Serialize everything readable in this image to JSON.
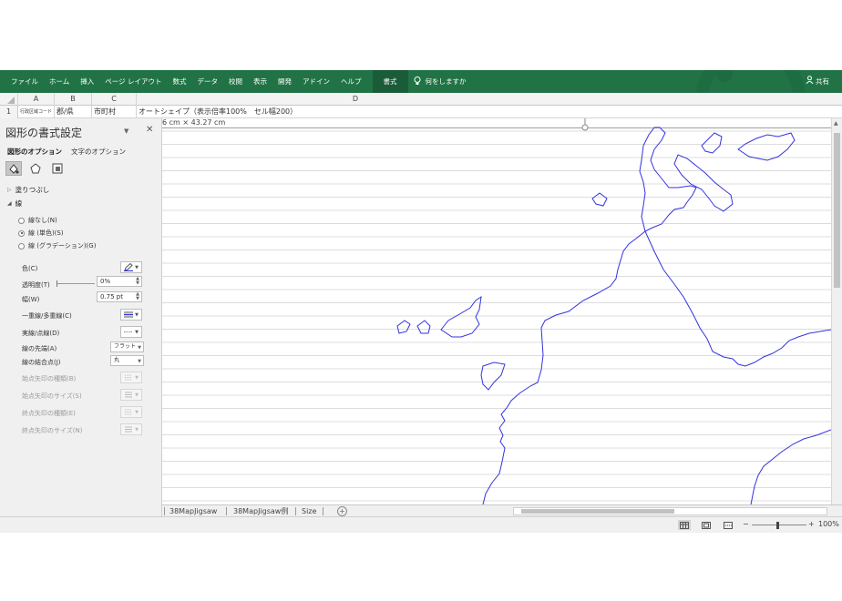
{
  "ribbon": {
    "tabs": [
      "ファイル",
      "ホーム",
      "挿入",
      "ページ レイアウト",
      "数式",
      "データ",
      "校閲",
      "表示",
      "開発",
      "アドイン",
      "ヘルプ",
      "書式"
    ],
    "active_tab": "書式",
    "tell_me": "何をしますか",
    "share": "共有",
    "accent_color": "#217346"
  },
  "columns": [
    "A",
    "B",
    "C",
    "D"
  ],
  "row1": {
    "num": "1",
    "a": "行政区域コード",
    "b": "郡/県",
    "c": "市町村",
    "d": "オートシェイプ（表示倍率100%　セル幅200）"
  },
  "shape_size_label": "6 cm × 43.27 cm",
  "pane": {
    "title": "図形の書式設定",
    "tab_shape": "図形のオプション",
    "tab_text": "文字のオプション",
    "fill_section": "塗りつぶし",
    "line_section": "線",
    "radio_none": "線なし(N)",
    "radio_solid": "線 (単色)(S)",
    "radio_gradient": "線 (グラデーション)(G)",
    "color_label": "色(C)",
    "transparency_label": "透明度(T)",
    "transparency_value": "0%",
    "width_label": "幅(W)",
    "width_value": "0.75 pt",
    "compound_label": "一重線/多重線(C)",
    "dash_label": "実線/点線(D)",
    "cap_label": "線の先端(A)",
    "cap_value": "フラット",
    "join_label": "線の結合点(J)",
    "join_value": "丸",
    "begin_arrow_type": "始点矢印の種類(B)",
    "begin_arrow_size": "始点矢印のサイズ(S)",
    "end_arrow_type": "終点矢印の種類(E)",
    "end_arrow_size": "終点矢印のサイズ(N)"
  },
  "sheets": [
    "38MapJigsaw",
    "38MapJigsaw例",
    "Size"
  ],
  "zoom": "100%",
  "map_line_color": "#3333e0"
}
